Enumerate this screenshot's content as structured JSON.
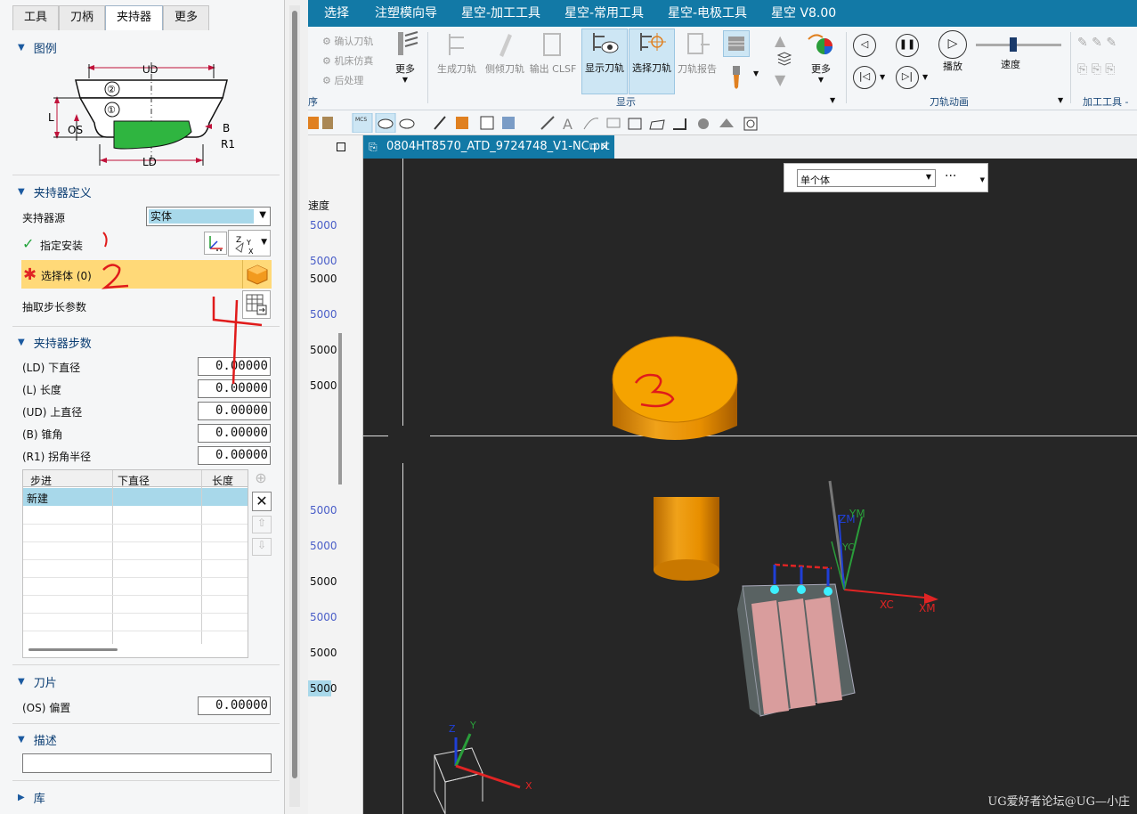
{
  "left_panel": {
    "tabs": [
      "工具",
      "刀柄",
      "夹持器",
      "更多"
    ],
    "active_tab": "夹持器",
    "legend": {
      "title": "图例",
      "labels": {
        "ud": "UD",
        "l": "L",
        "os": "OS",
        "b": "B",
        "r1": "R1",
        "ld": "LD",
        "c2": "②",
        "c1": "①"
      }
    },
    "holder_def": {
      "title": "夹持器定义",
      "source_label": "夹持器源",
      "source_value": "实体",
      "specify_install": "指定安装",
      "select_body": "选择体 (0)",
      "extract_params": "抽取步长参数"
    },
    "holder_steps": {
      "title": "夹持器步数",
      "params": [
        {
          "label": "(LD) 下直径",
          "value": "0.00000"
        },
        {
          "label": "(L) 长度",
          "value": "0.00000"
        },
        {
          "label": "(UD) 上直径",
          "value": "0.00000"
        },
        {
          "label": "(B) 锥角",
          "value": "0.00000"
        },
        {
          "label": "(R1) 拐角半径",
          "value": "0.00000"
        }
      ],
      "table_headers": [
        "步进",
        "下直径",
        "长度"
      ],
      "table_rows": [
        [
          "新建",
          "",
          ""
        ]
      ]
    },
    "blade": {
      "title": "刀片",
      "offset_label": "(OS) 偏置",
      "offset_value": "0.00000"
    },
    "description": {
      "title": "描述",
      "value": ""
    },
    "library": {
      "title": "库"
    }
  },
  "ribbon": {
    "tabs": [
      "选择",
      "注塑模向导",
      "星空-加工工具",
      "星空-常用工具",
      "星空-电极工具",
      "星空 V8.00"
    ],
    "small_items": [
      "确认刀轨",
      "机床仿真",
      "后处理"
    ],
    "more_label": "更多",
    "buttons": [
      "生成刀轨",
      "侧倾刀轨",
      "输出 CLSF",
      "显示刀轨",
      "选择刀轨",
      "刀轨报告"
    ],
    "more2_label": "更多",
    "play_label": "播放",
    "speed_label": "速度",
    "groups": {
      "order": "序",
      "display": "显示",
      "anim": "刀轨动画",
      "tools": "加工工具 - G"
    }
  },
  "nav_values": [
    "速度",
    "5000",
    "5000",
    "5000",
    "5000",
    "5000",
    "5000",
    "5000",
    "5000",
    "5000",
    "5000",
    "5000",
    "5000"
  ],
  "document": {
    "tab_title": "0804HT8570_ATD_9724748_V1-NC.prt"
  },
  "viewport": {
    "filter_value": "单个体",
    "filter_more": "···",
    "axis_labels": {
      "xc": "XC",
      "xm": "XM",
      "zm": "ZM",
      "ym": "YM",
      "yc": "YC",
      "x": "X",
      "y": "Y",
      "z": "Z"
    },
    "watermark": "UG爱好者论坛@UG—小庄"
  },
  "annotations": [
    "1",
    "2",
    "3",
    "4"
  ]
}
